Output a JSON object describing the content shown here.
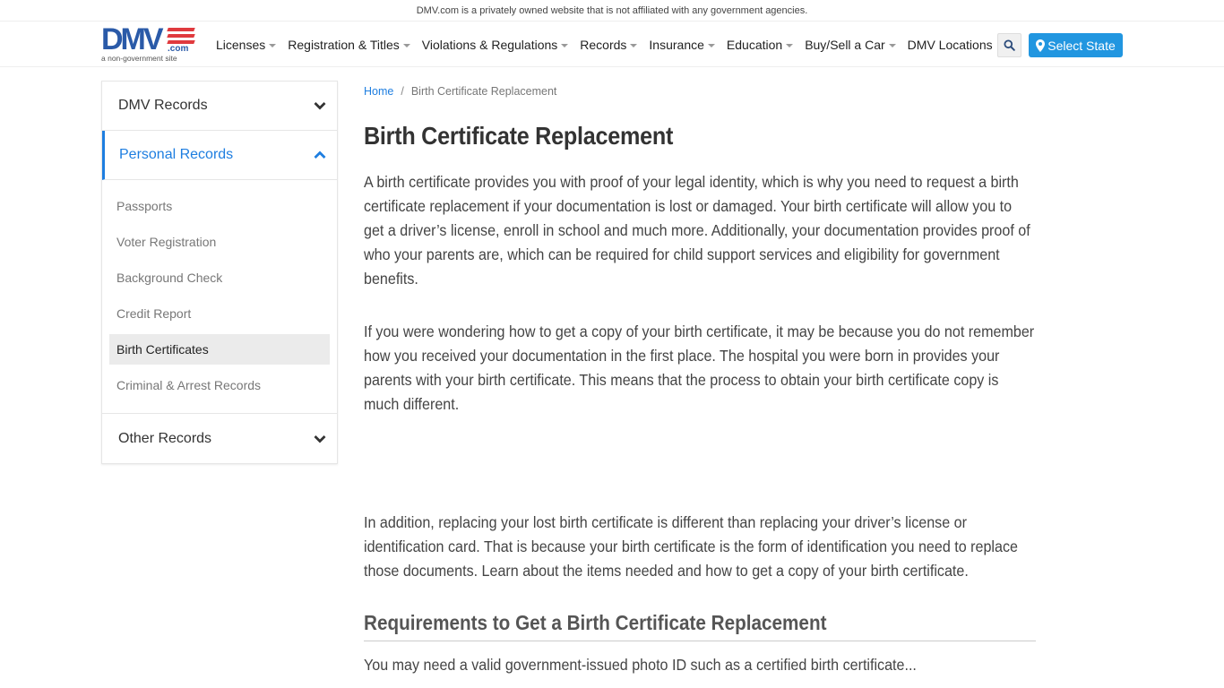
{
  "topbar": {
    "disclaimer": "DMV.com is a privately owned website that is not affiliated with any government agencies."
  },
  "header": {
    "logo": {
      "main": "DMV",
      "suffix": ".com",
      "tagline": "a non-government site"
    },
    "nav": [
      {
        "label": "Licenses",
        "dropdown": true
      },
      {
        "label": "Registration & Titles",
        "dropdown": true
      },
      {
        "label": "Violations & Regulations",
        "dropdown": true
      },
      {
        "label": "Records",
        "dropdown": true
      },
      {
        "label": "Insurance",
        "dropdown": true
      },
      {
        "label": "Education",
        "dropdown": true
      },
      {
        "label": "Buy/Sell a Car",
        "dropdown": true
      },
      {
        "label": "DMV Locations",
        "dropdown": false
      }
    ],
    "search_icon": "search-icon",
    "select_state_label": "Select State",
    "select_state_icon": "map-marker-icon"
  },
  "colors": {
    "accent": "#1e7ee0",
    "button": "#2196e0",
    "logo_blue": "#2a5aa8",
    "logo_red": "#e03a3e"
  },
  "sidebar": {
    "sections": [
      {
        "label": "DMV Records",
        "expanded": false
      },
      {
        "label": "Personal Records",
        "expanded": true
      },
      {
        "label": "Other Records",
        "expanded": false
      }
    ],
    "items": [
      {
        "label": "Passports"
      },
      {
        "label": "Voter Registration"
      },
      {
        "label": "Background Check"
      },
      {
        "label": "Credit Report"
      },
      {
        "label": "Birth Certificates",
        "selected": true
      },
      {
        "label": "Criminal & Arrest Records"
      }
    ]
  },
  "main": {
    "breadcrumb": {
      "home": "Home",
      "separator": "/",
      "current": "Birth Certificate Replacement"
    },
    "title": "Birth Certificate Replacement",
    "paragraphs": [
      "A birth certificate provides you with proof of your legal identity, which is why you need to request a birth certificate replacement if your documentation is lost or damaged. Your birth certificate will allow you to get a driver’s license, enroll in school and much more. Additionally, your documentation provides proof of who your parents are, which can be required for child support services and eligibility for government benefits.",
      "If you were wondering how to get a copy of your birth certificate, it may be because you do not remember how you received your documentation in the first place. The hospital you were born in provides your parents with your birth certificate. This means that the process to obtain your birth certificate copy is much different.",
      "In addition, replacing your lost birth certificate is different than replacing your driver’s license or identification card. That is because your birth certificate is the form of identification you need to replace those documents. Learn about the items needed and how to get a copy of your birth certificate."
    ],
    "section_heading": "Requirements to Get a Birth Certificate Replacement",
    "cutoff_text": "You may need a valid government-issued photo ID such as a certified birth certificate..."
  }
}
